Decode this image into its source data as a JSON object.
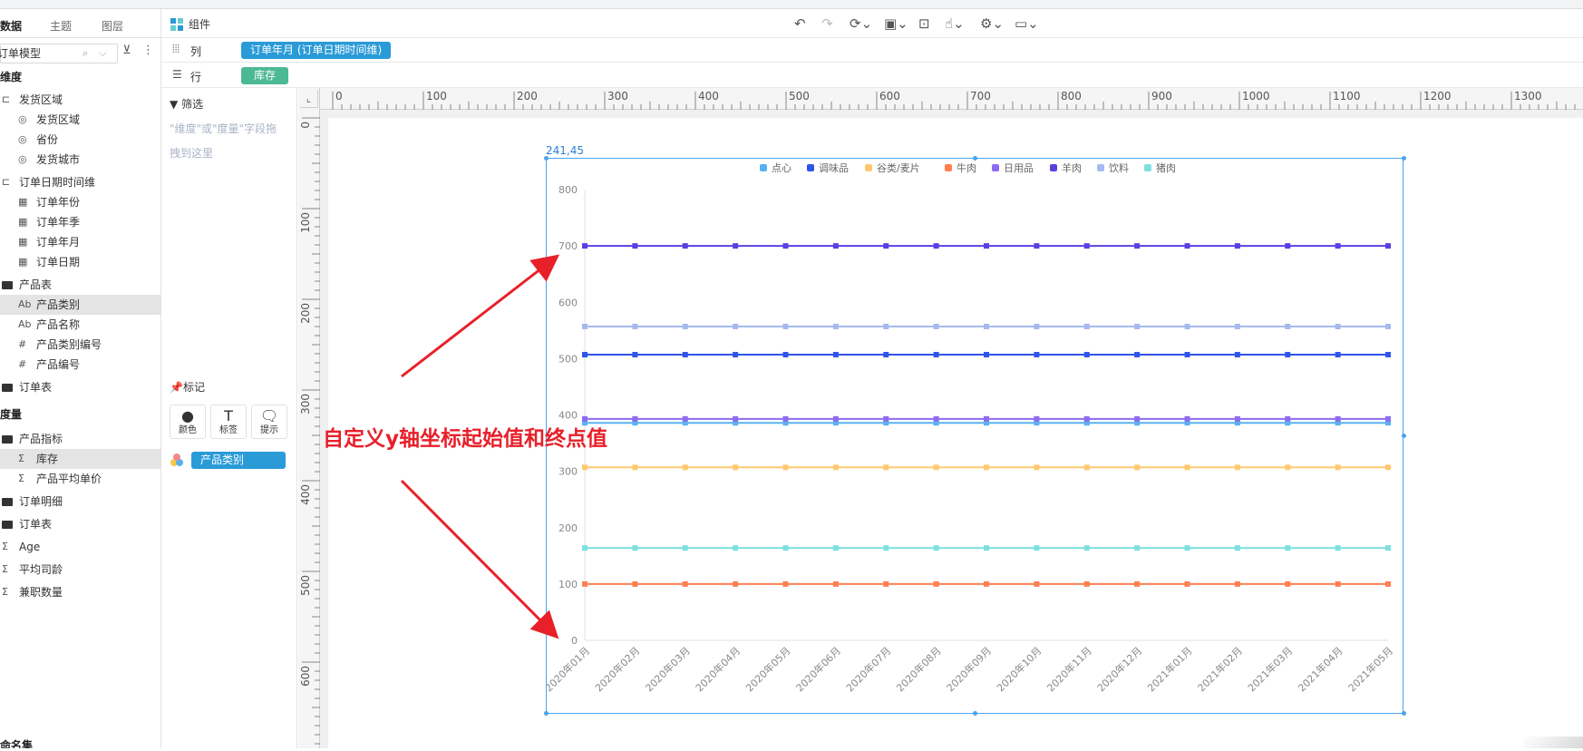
{
  "left_panel": {
    "tabs": [
      "数据",
      "主题",
      "图层"
    ],
    "model_select": "订单模型",
    "dimension_title": "维度",
    "dimensions": [
      {
        "label": "发货区域",
        "icon": "hierarchy-icon",
        "level": 0
      },
      {
        "label": "发货区域",
        "icon": "globe-icon",
        "level": 1
      },
      {
        "label": "省份",
        "icon": "globe-icon",
        "level": 1
      },
      {
        "label": "发货城市",
        "icon": "globe-icon",
        "level": 1
      },
      {
        "label": "订单日期时间维",
        "icon": "hierarchy-icon",
        "level": 0
      },
      {
        "label": "订单年份",
        "icon": "date-icon",
        "level": 1
      },
      {
        "label": "订单年季",
        "icon": "date-icon",
        "level": 1
      },
      {
        "label": "订单年月",
        "icon": "date-icon",
        "level": 1
      },
      {
        "label": "订单日期",
        "icon": "date-icon",
        "level": 1
      },
      {
        "label": "产品表",
        "icon": "folder-icon",
        "level": 0
      },
      {
        "label": "产品类别",
        "icon": "text-field-icon",
        "level": 1,
        "selected": true
      },
      {
        "label": "产品名称",
        "icon": "text-field-icon",
        "level": 1
      },
      {
        "label": "产品类别编号",
        "icon": "number-field-icon",
        "level": 1
      },
      {
        "label": "产品编号",
        "icon": "number-field-icon",
        "level": 1
      },
      {
        "label": "订单表",
        "icon": "folder-icon",
        "level": 0
      }
    ],
    "measure_title": "度量",
    "measures": [
      {
        "label": "产品指标",
        "icon": "folder-icon",
        "level": 0
      },
      {
        "label": "库存",
        "icon": "sum-icon",
        "level": 1,
        "selected": true
      },
      {
        "label": "产品平均单价",
        "icon": "sum-icon",
        "level": 1
      },
      {
        "label": "订单明细",
        "icon": "folder-icon",
        "level": 0
      },
      {
        "label": "订单表",
        "icon": "folder-icon",
        "level": 0
      },
      {
        "label": "Age",
        "icon": "sum-icon",
        "level": 0
      },
      {
        "label": "平均司龄",
        "icon": "calc-sum-icon",
        "level": 0
      },
      {
        "label": "兼职数量",
        "icon": "calc-sum-icon",
        "level": 0
      }
    ],
    "bottom_label": "命名集"
  },
  "component_bar": {
    "title": "组件",
    "tools": [
      "undo-icon",
      "redo-icon",
      "refresh-icon",
      "save-icon",
      "search-icon",
      "hand-icon",
      "settings-icon",
      "monitor-icon"
    ]
  },
  "shelves": {
    "column_label": "列",
    "column_pill": "订单年月 (订单日期时间维)",
    "row_label": "行",
    "row_pill": "库存"
  },
  "filter": {
    "title": "筛选",
    "hint": "\"维度\"或\"度量\"字段拖拽到这里"
  },
  "marks": {
    "title": "标记",
    "buttons": [
      {
        "label": "颜色",
        "icon": "color-icon"
      },
      {
        "label": "标签",
        "icon": "text-icon"
      },
      {
        "label": "提示",
        "icon": "tooltip-icon"
      }
    ],
    "color_field": "产品类别"
  },
  "canvas": {
    "ruler_top": [
      "0",
      "100",
      "200",
      "300",
      "400",
      "500",
      "600",
      "700",
      "800",
      "900",
      "1000",
      "1100",
      "1200",
      "1300"
    ],
    "ruler_left": [
      "0",
      "100",
      "200",
      "300",
      "400",
      "500",
      "600"
    ],
    "chart_position_label": "241,45"
  },
  "annotation": "自定义y轴坐标起始值和终点值",
  "chart_data": {
    "type": "line",
    "categories": [
      "2020年01月",
      "2020年02月",
      "2020年03月",
      "2020年04月",
      "2020年05月",
      "2020年06月",
      "2020年07月",
      "2020年08月",
      "2020年09月",
      "2020年10月",
      "2020年11月",
      "2020年12月",
      "2021年01月",
      "2021年02月",
      "2021年03月",
      "2021年04月",
      "2021年05月"
    ],
    "ylim": [
      0,
      800
    ],
    "yticks": [
      0,
      100,
      200,
      300,
      400,
      500,
      600,
      700,
      800
    ],
    "legend_position": "top",
    "series": [
      {
        "name": "点心",
        "color": "#5ab1ef",
        "value": 386
      },
      {
        "name": "调味品",
        "color": "#2f54eb",
        "value": 507
      },
      {
        "name": "谷类/麦片",
        "color": "#ffc970",
        "value": 307
      },
      {
        "name": "牛肉",
        "color": "#ff7f50",
        "value": 100
      },
      {
        "name": "日用品",
        "color": "#8c6cf0",
        "value": 393
      },
      {
        "name": "羊肉",
        "color": "#5b3fe0",
        "value": 700
      },
      {
        "name": "饮料",
        "color": "#a4b9ef",
        "value": 557
      },
      {
        "name": "猪肉",
        "color": "#7ee0e0",
        "value": 164
      }
    ]
  }
}
